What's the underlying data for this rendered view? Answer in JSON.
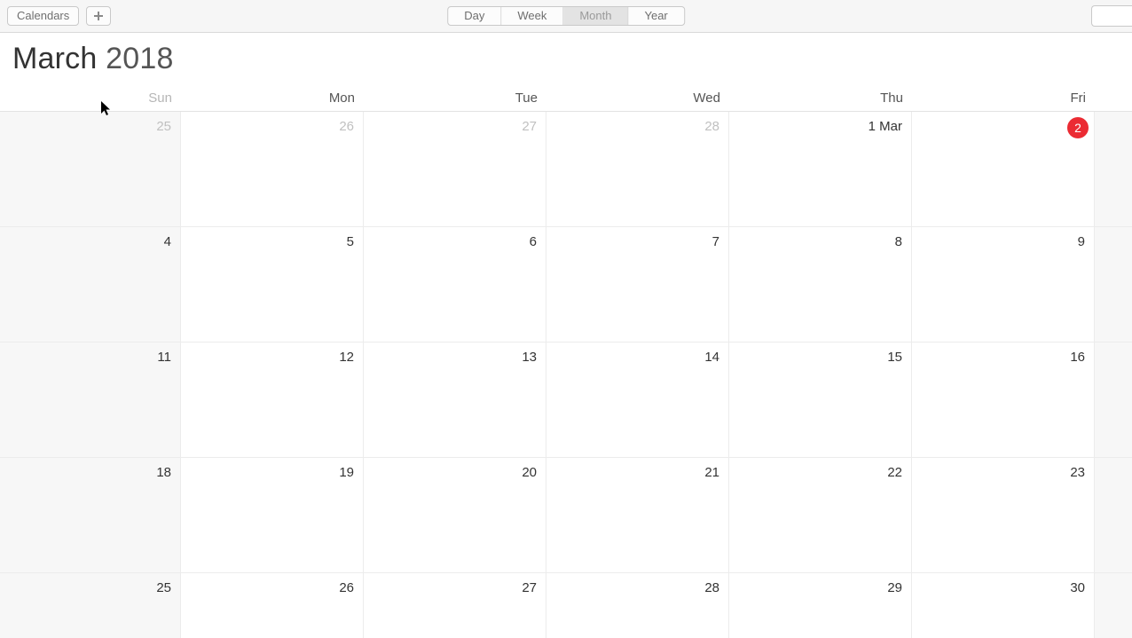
{
  "toolbar": {
    "calendars_label": "Calendars",
    "add_icon": "plus-icon",
    "views": {
      "day": "Day",
      "week": "Week",
      "month": "Month",
      "year": "Year",
      "active": "Month"
    }
  },
  "header": {
    "month": "March",
    "year": "2018"
  },
  "weekdays": [
    "Sun",
    "Mon",
    "Tue",
    "Wed",
    "Thu",
    "Fri"
  ],
  "weeks": [
    [
      {
        "label": "25",
        "weekend": true,
        "muted": true
      },
      {
        "label": "26",
        "muted": true
      },
      {
        "label": "27",
        "muted": true
      },
      {
        "label": "28",
        "muted": true
      },
      {
        "label": "1 Mar"
      },
      {
        "label": "2",
        "today": true
      }
    ],
    [
      {
        "label": "4",
        "weekend": true
      },
      {
        "label": "5"
      },
      {
        "label": "6"
      },
      {
        "label": "7"
      },
      {
        "label": "8"
      },
      {
        "label": "9"
      }
    ],
    [
      {
        "label": "11",
        "weekend": true
      },
      {
        "label": "12"
      },
      {
        "label": "13"
      },
      {
        "label": "14"
      },
      {
        "label": "15"
      },
      {
        "label": "16"
      }
    ],
    [
      {
        "label": "18",
        "weekend": true
      },
      {
        "label": "19"
      },
      {
        "label": "20"
      },
      {
        "label": "21"
      },
      {
        "label": "22"
      },
      {
        "label": "23"
      }
    ],
    [
      {
        "label": "25",
        "weekend": true
      },
      {
        "label": "26"
      },
      {
        "label": "27"
      },
      {
        "label": "28"
      },
      {
        "label": "29"
      },
      {
        "label": "30"
      }
    ]
  ]
}
